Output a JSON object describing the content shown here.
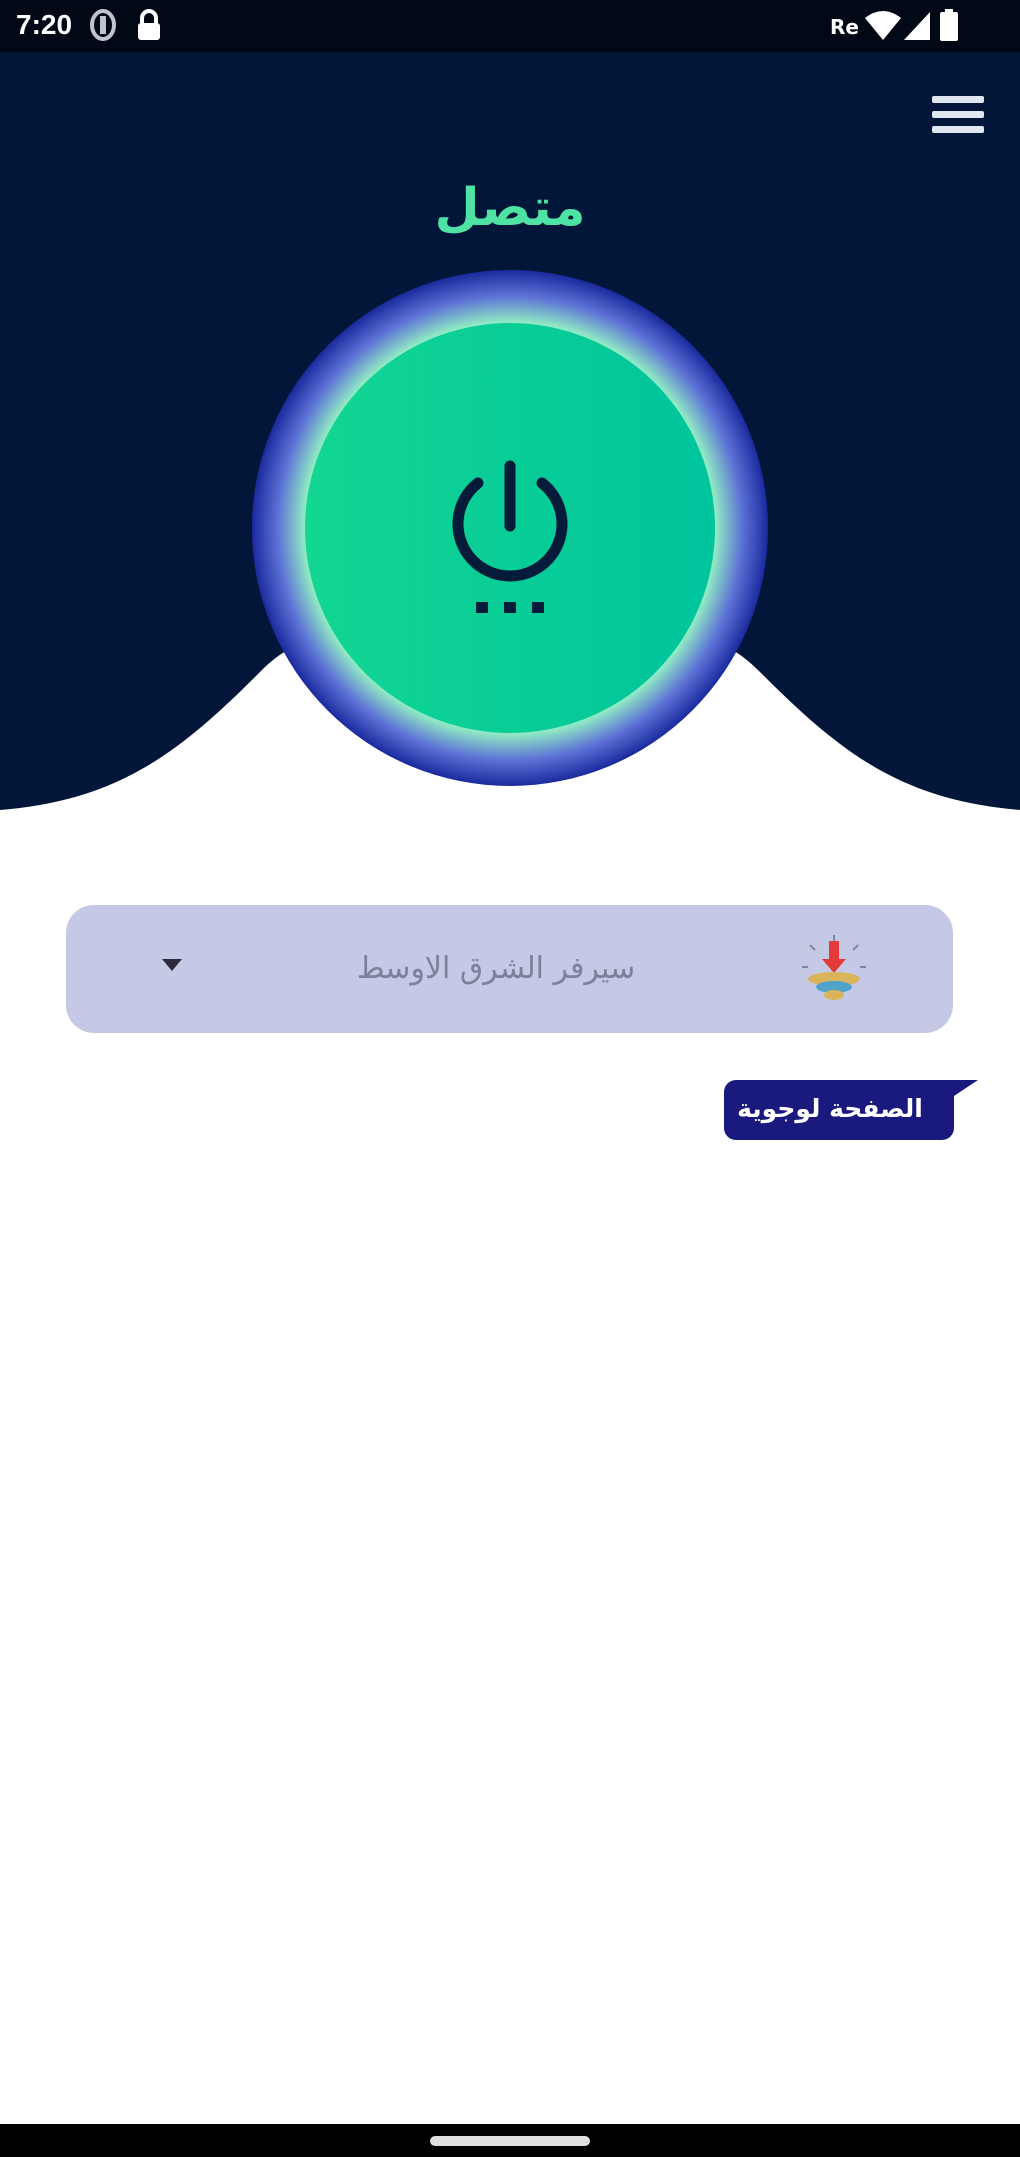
{
  "status_bar": {
    "time": "7:20",
    "icons": [
      "vpn-key-icon",
      "lock-icon",
      "cellular-label-icon",
      "wifi-icon",
      "signal-icon",
      "battery-icon"
    ]
  },
  "header": {
    "menu_icon": "hamburger-menu-icon",
    "status_text": "متصل",
    "power_icon": "power-icon",
    "loading_indicator": "three-dots-icon"
  },
  "server": {
    "selected": "سيرفر الشرق الاوسط",
    "flag_icon": "server-flag-icon",
    "arrow_icon": "chevron-down-icon"
  },
  "promo": {
    "label": "الصفحة لوجوية"
  },
  "colors": {
    "header_bg": "#011638",
    "status_text": "#4ee3a4",
    "power_fill": "#00cc96",
    "power_icon": "#041b3a",
    "glow_outer": "#1a2a9e",
    "glow_inner": "#a6f2cf",
    "server_bg": "#c5c9e6",
    "promo_bg": "#1a1a7e"
  }
}
